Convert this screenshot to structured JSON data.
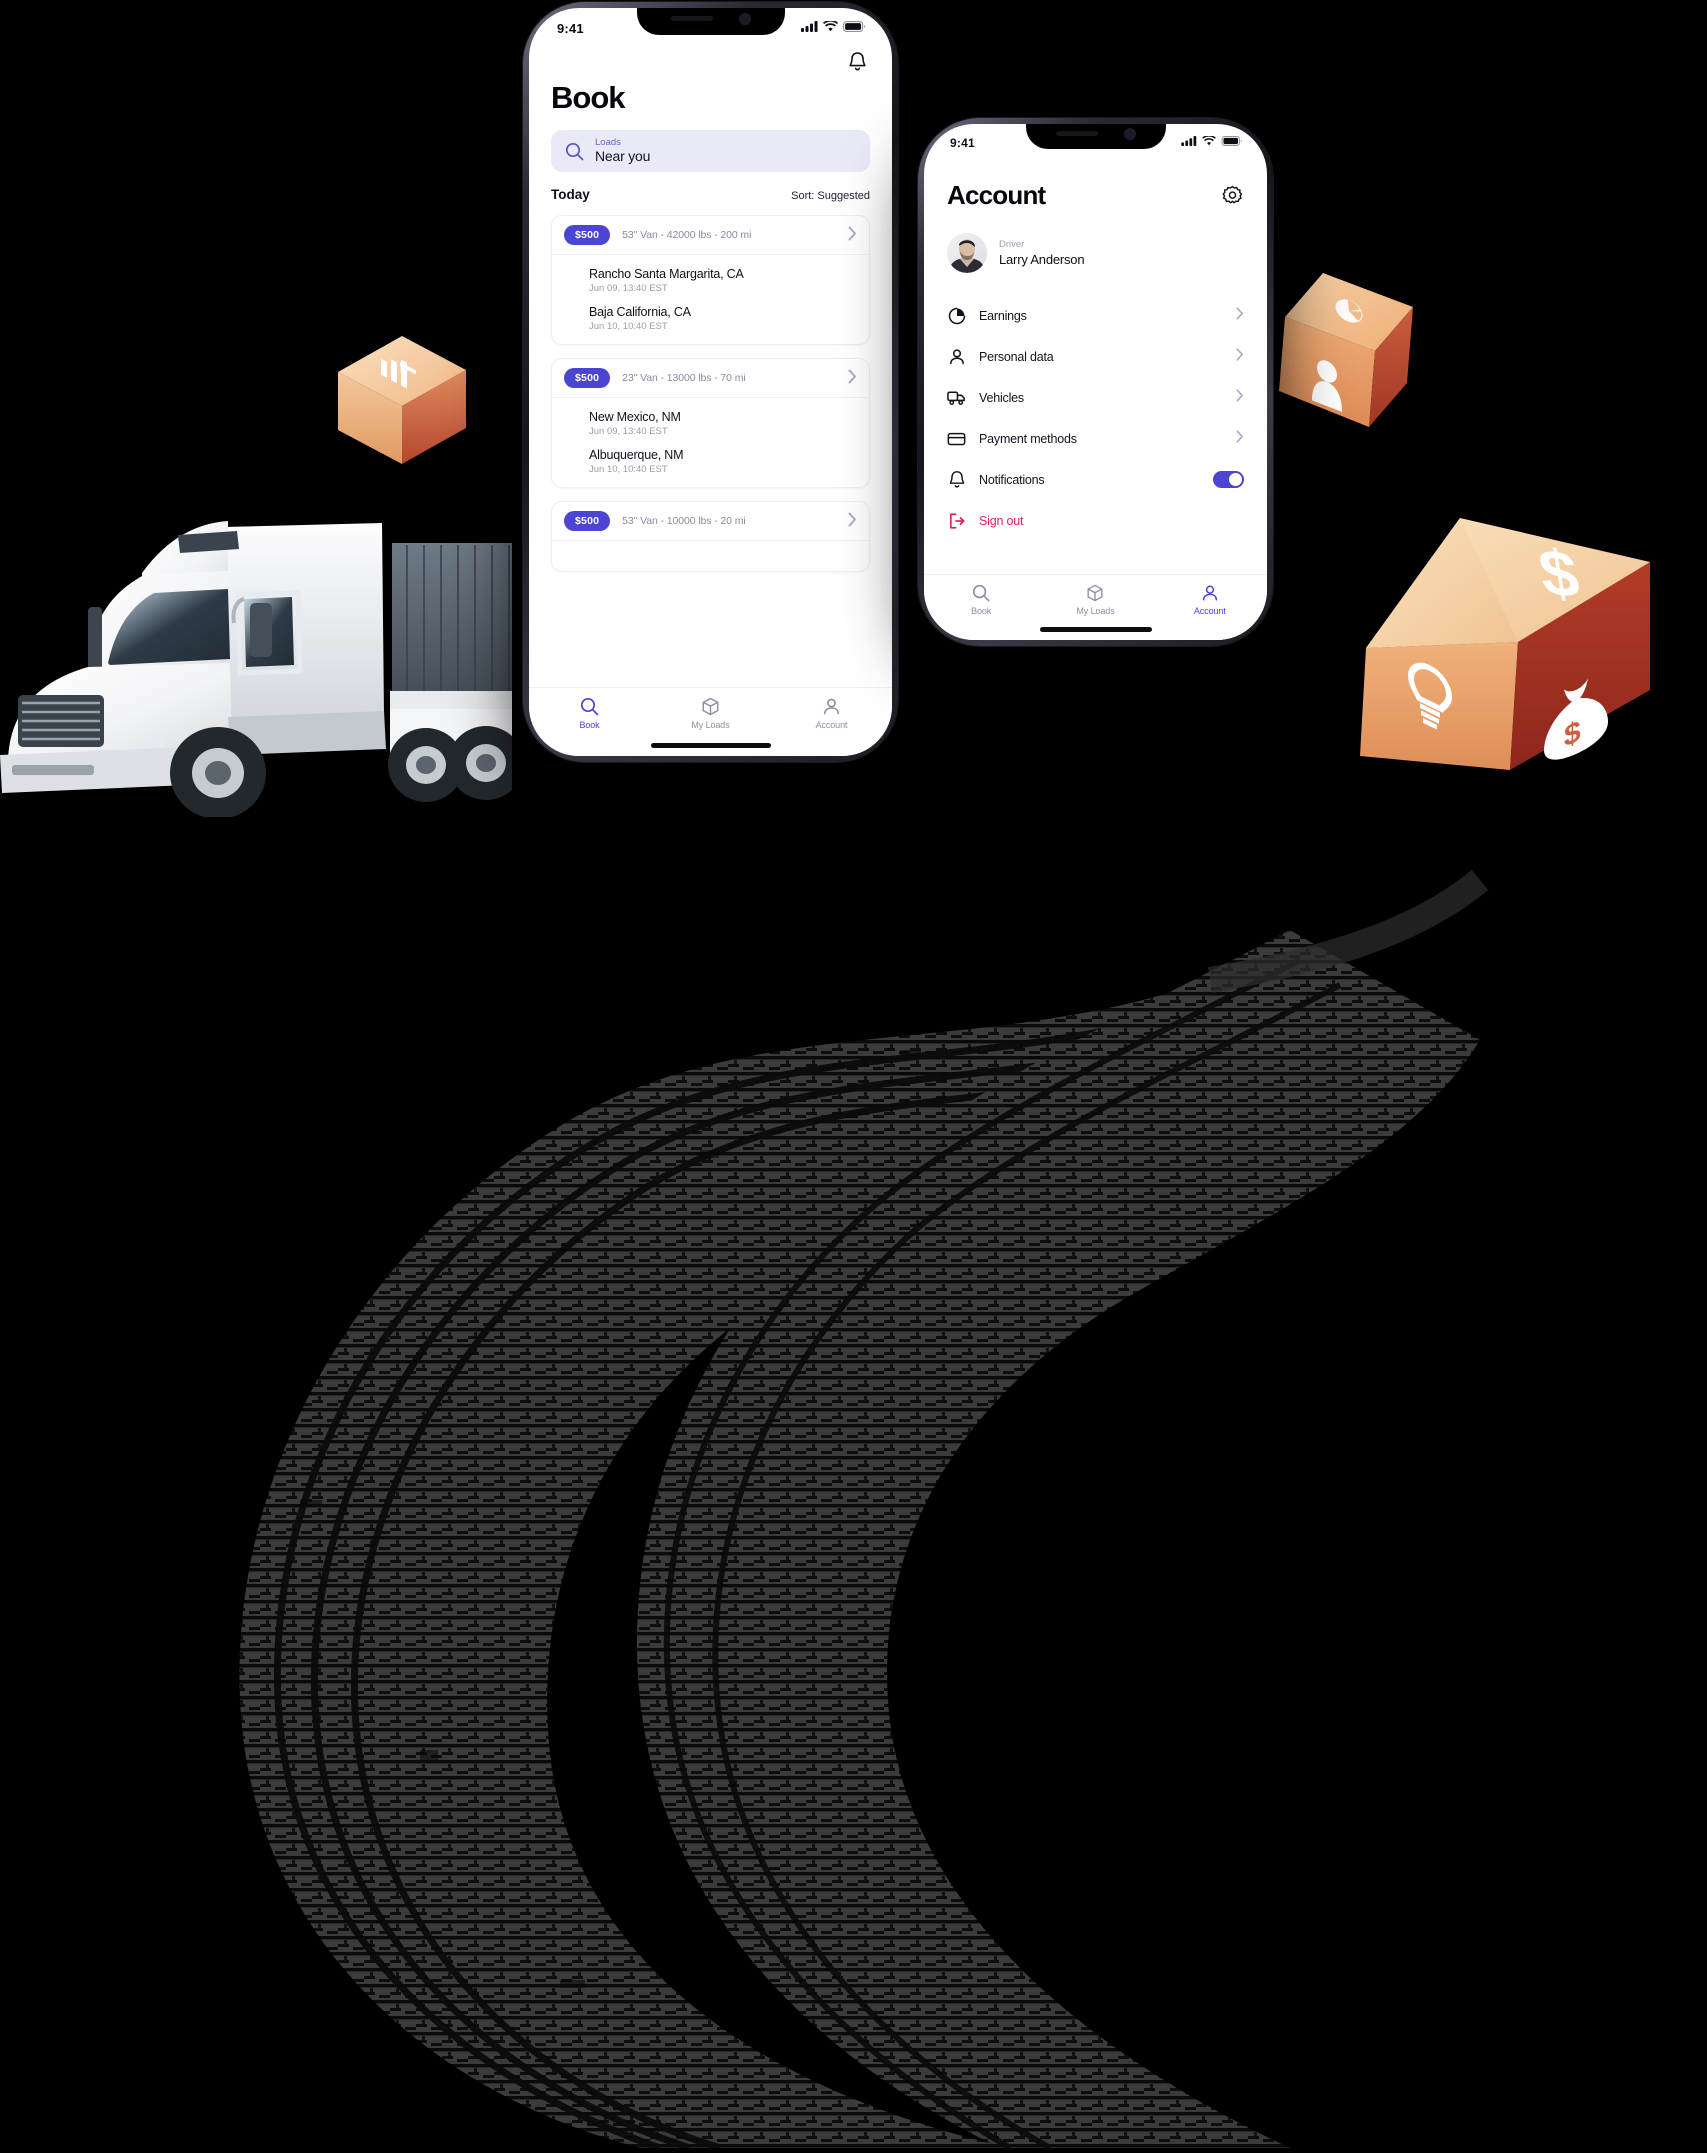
{
  "scene": {
    "background_color": "#000000",
    "tire_track_color": "#3a3a3a",
    "accent_purple": "#4B45D1",
    "danger_red": "#E0245E"
  },
  "decor": {
    "truck": {
      "name": "semi-truck-illustration",
      "body_color": "#FFFFFF",
      "trailer_color": "#5A6672"
    },
    "cubes": [
      {
        "name": "cube-bar-chart",
        "top_icon": "bar-chart-up-icon",
        "top_color": "#F3CDA2",
        "left_color": "#E8A46F",
        "right_color": "#C4563F"
      },
      {
        "name": "cube-person",
        "top_icon": "pie-chart-icon",
        "front_icon": "person-icon",
        "top_color": "#F0BE8E",
        "left_color": "#E79A63",
        "right_color": "#B94430"
      },
      {
        "name": "cube-money",
        "top_icon": "dollar-sign-icon",
        "left_icon": "lightbulb-icon",
        "front_icon": "money-bag-icon",
        "top_color": "#F5D3A6",
        "left_color": "#E79C62",
        "right_color": "#A83225"
      }
    ]
  },
  "phone_book": {
    "status_bar": {
      "time": "9:41",
      "signal": "cellular-signal-icon",
      "wifi": "wifi-icon",
      "battery": "battery-full-icon"
    },
    "notification_icon": "bell-icon",
    "title": "Book",
    "search": {
      "icon": "search-icon",
      "label": "Loads",
      "value": "Near you"
    },
    "today_label": "Today",
    "sort_label": "Sort: Suggested",
    "cards": [
      {
        "price": "$500",
        "spec": "53\" Van - 42000 lbs - 200 mi",
        "origin": {
          "name": "Rancho Santa Margarita, CA",
          "date": "Jun 09, 13:40 EST"
        },
        "destination": {
          "name": "Baja California, CA",
          "date": "Jun 10, 10:40 EST"
        }
      },
      {
        "price": "$500",
        "spec": "23\" Van - 13000 lbs - 70 mi",
        "origin": {
          "name": "New Mexico, NM",
          "date": "Jun 09, 13:40 EST"
        },
        "destination": {
          "name": "Albuquerque, NM",
          "date": "Jun 10, 10:40 EST"
        }
      },
      {
        "price": "$500",
        "spec": "53\" Van - 10000 lbs - 20 mi",
        "origin": null,
        "destination": null
      }
    ],
    "tabs": [
      {
        "label": "Book",
        "icon": "search-icon",
        "active": true
      },
      {
        "label": "My Loads",
        "icon": "package-icon",
        "active": false
      },
      {
        "label": "Account",
        "icon": "person-icon",
        "active": false
      }
    ]
  },
  "phone_account": {
    "status_bar": {
      "time": "9:41",
      "signal": "cellular-signal-icon",
      "wifi": "wifi-icon",
      "battery": "battery-full-icon"
    },
    "title": "Account",
    "settings_icon": "gear-icon",
    "profile": {
      "role": "Driver",
      "name": "Larry Anderson",
      "avatar": "user-photo-avatar"
    },
    "menu": [
      {
        "label": "Earnings",
        "icon": "pie-chart-icon",
        "control": "chevron-right-icon"
      },
      {
        "label": "Personal data",
        "icon": "person-icon",
        "control": "chevron-right-icon"
      },
      {
        "label": "Vehicles",
        "icon": "truck-icon",
        "control": "chevron-right-icon"
      },
      {
        "label": "Payment methods",
        "icon": "credit-card-icon",
        "control": "chevron-right-icon"
      },
      {
        "label": "Notifications",
        "icon": "bell-icon",
        "control": "toggle-on"
      },
      {
        "label": "Sign out",
        "icon": "sign-out-icon",
        "control": "none",
        "danger": true
      }
    ],
    "tabs": [
      {
        "label": "Book",
        "icon": "search-icon",
        "active": false
      },
      {
        "label": "My Loads",
        "icon": "package-icon",
        "active": false
      },
      {
        "label": "Account",
        "icon": "person-icon",
        "active": true
      }
    ]
  }
}
